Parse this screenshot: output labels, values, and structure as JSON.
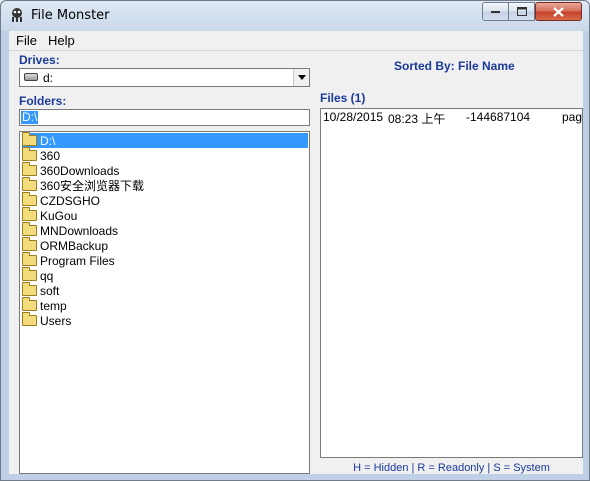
{
  "window": {
    "title": "File Monster"
  },
  "menu": {
    "file": "File",
    "help": "Help"
  },
  "drives": {
    "label": "Drives:",
    "selected": "d:"
  },
  "folders": {
    "label": "Folders:",
    "path": "D:\\",
    "tree": [
      "D:\\",
      "360",
      "360Downloads",
      "360安全浏览器下载",
      "CZDSGHO",
      "KuGou",
      "MNDownloads",
      "ORMBackup",
      "Program Files",
      "qq",
      "soft",
      "temp",
      "Users"
    ]
  },
  "sorted_by": "Sorted By: File Name",
  "files": {
    "label": "Files (1)",
    "rows": [
      {
        "date": "10/28/2015",
        "time": "08:23 上午",
        "size": "-144687104",
        "name": "page"
      }
    ]
  },
  "legend": "H = Hidden   |   R = Readonly   |   S = System"
}
